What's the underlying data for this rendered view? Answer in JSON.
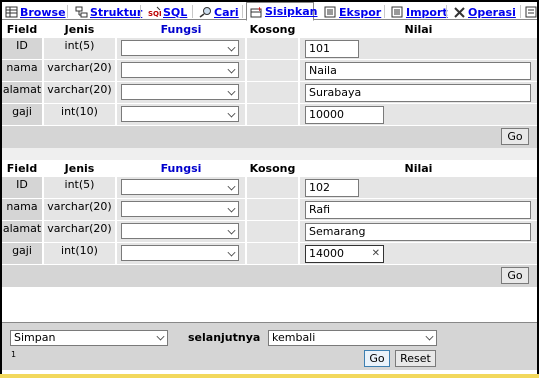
{
  "tabs": [
    {
      "label": "Browse",
      "icon": "browse-icon"
    },
    {
      "label": "Struktur",
      "icon": "structure-icon"
    },
    {
      "label": "SQL",
      "icon": "sql-icon"
    },
    {
      "label": "Cari",
      "icon": "search-icon"
    },
    {
      "label": "Sisipkan",
      "icon": "insert-icon",
      "active": true
    },
    {
      "label": "Ekspor",
      "icon": "export-icon"
    },
    {
      "label": "Import",
      "icon": "import-icon"
    },
    {
      "label": "Operasi",
      "icon": "operations-icon"
    }
  ],
  "table_headers": {
    "field": "Field",
    "jenis": "Jenis",
    "fungsi": "Fungsi",
    "kosong": "Kosong",
    "nilai": "Nilai"
  },
  "records": [
    {
      "rows": [
        {
          "field": "ID",
          "jenis": "int(5)",
          "value": "101"
        },
        {
          "field": "nama",
          "jenis": "varchar(20)",
          "value": "Naila"
        },
        {
          "field": "alamat",
          "jenis": "varchar(20)",
          "value": "Surabaya"
        },
        {
          "field": "gaji",
          "jenis": "int(10)",
          "value": "10000"
        }
      ],
      "go_label": "Go"
    },
    {
      "rows": [
        {
          "field": "ID",
          "jenis": "int(5)",
          "value": "102"
        },
        {
          "field": "nama",
          "jenis": "varchar(20)",
          "value": "Rafi"
        },
        {
          "field": "alamat",
          "jenis": "varchar(20)",
          "value": "Semarang"
        },
        {
          "field": "gaji",
          "jenis": "int(10)",
          "value": "14000"
        }
      ],
      "go_label": "Go"
    }
  ],
  "footer": {
    "action_select": "Simpan",
    "next_label": "selanjutnya",
    "next_select": "kembali",
    "footnote": "1",
    "go_label": "Go",
    "reset_label": "Reset"
  },
  "colors": {
    "link": "#0000ee",
    "fungsi_header": "#0000cc",
    "field_bg": "#d5d5d5",
    "cell_bg": "#e5e5e5",
    "bottom_bar": "#f2d85c"
  }
}
